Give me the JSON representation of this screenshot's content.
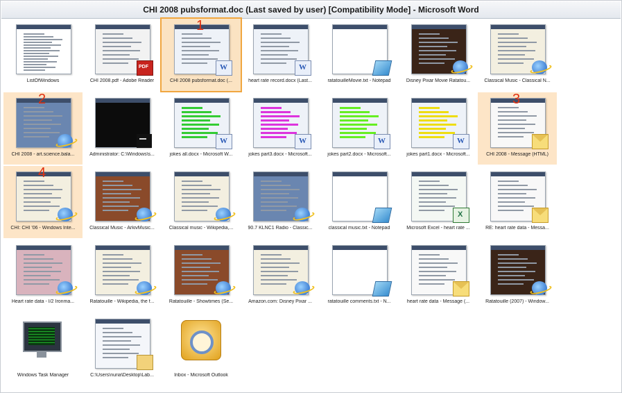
{
  "window": {
    "title": "CHI 2008 pubsformat.doc (Last saved by user) [Compatibility Mode] - Microsoft Word"
  },
  "accent_colors": {
    "highlight": "#fde5c7",
    "selected_border": "#f0a640",
    "number": "#e03010"
  },
  "rows": [
    [
      {
        "caption": "ListOfWindows",
        "badge": "none",
        "number": "",
        "state": "normal",
        "thumb": "list"
      },
      {
        "caption": "CHI 2008.pdf - Adobe Reader",
        "badge": "pdf-icon",
        "number": "",
        "state": "normal",
        "thumb": "pdf"
      },
      {
        "caption": "CHI 2008 pubsformat.doc (...",
        "badge": "word-doc-icon",
        "number": "1",
        "state": "selected",
        "thumb": "word"
      },
      {
        "caption": "heart rate record.docx (Last...",
        "badge": "word-doc-icon",
        "number": "",
        "state": "normal",
        "thumb": "word"
      },
      {
        "caption": "ratatouilleMovie.txt - Notepad",
        "badge": "notepad-icon",
        "number": "",
        "state": "normal",
        "thumb": "blank"
      },
      {
        "caption": "Disney Pixar Movie Ratatou...",
        "badge": "ie-icon",
        "number": "",
        "state": "normal",
        "thumb": "web-dark"
      },
      {
        "caption": "Classical Music - Classical N...",
        "badge": "ie-icon",
        "number": "",
        "state": "normal",
        "thumb": "web-light"
      }
    ],
    [
      {
        "caption": "CHI 2008 - art.science.bala...",
        "badge": "ie-icon",
        "number": "2",
        "state": "highlight",
        "thumb": "web-blue"
      },
      {
        "caption": "Administrator: C:\\Windows\\s...",
        "badge": "terminal-icon",
        "number": "",
        "state": "normal",
        "thumb": "console"
      },
      {
        "caption": "jokes all.docx - Microsoft W...",
        "badge": "word-doc-icon",
        "number": "",
        "state": "normal",
        "thumb": "word-green"
      },
      {
        "caption": "jokes part3.docx - Microsoft...",
        "badge": "word-doc-icon",
        "number": "",
        "state": "normal",
        "thumb": "word-magenta"
      },
      {
        "caption": "jokes part2.docx - Microsoft...",
        "badge": "word-doc-icon",
        "number": "",
        "state": "normal",
        "thumb": "word-lime"
      },
      {
        "caption": "jokes part1.docx - Microsoft...",
        "badge": "word-doc-icon",
        "number": "",
        "state": "normal",
        "thumb": "word-yellow"
      },
      {
        "caption": "CHI 2008 - Message (HTML)",
        "badge": "mail-icon",
        "number": "3",
        "state": "highlight",
        "thumb": "mail"
      }
    ],
    [
      {
        "caption": "CHI: CHI '06 - Windows Inte...",
        "badge": "ie-icon",
        "number": "4",
        "state": "highlight",
        "thumb": "web-light"
      },
      {
        "caption": "Classical Music - ArkivMusic...",
        "badge": "ie-icon",
        "number": "",
        "state": "normal",
        "thumb": "web-brown"
      },
      {
        "caption": "Classical music - Wikipedia,...",
        "badge": "ie-icon",
        "number": "",
        "state": "normal",
        "thumb": "web-light"
      },
      {
        "caption": "90.7 KLNC1 Radio - Classic...",
        "badge": "ie-icon",
        "number": "",
        "state": "normal",
        "thumb": "web-blue"
      },
      {
        "caption": "classical music.txt - Notepad",
        "badge": "notepad-icon",
        "number": "",
        "state": "normal",
        "thumb": "blank"
      },
      {
        "caption": "Microsoft Excel - heart rate ...",
        "badge": "excel-icon",
        "number": "",
        "state": "normal",
        "thumb": "sheet"
      },
      {
        "caption": "RE: heart rate data - Messa...",
        "badge": "mail-icon",
        "number": "",
        "state": "normal",
        "thumb": "mail"
      }
    ],
    [
      {
        "caption": "Heart rate data - I/2 Ironma...",
        "badge": "ie-icon",
        "number": "",
        "state": "normal",
        "thumb": "web-pink"
      },
      {
        "caption": "Ratatouille - Wikipedia, the f...",
        "badge": "ie-icon",
        "number": "",
        "state": "normal",
        "thumb": "web-light"
      },
      {
        "caption": "Ratatouille - Showtimes (Se...",
        "badge": "ie-icon",
        "number": "",
        "state": "normal",
        "thumb": "web-brown"
      },
      {
        "caption": "Amazon.com: Disney Pixar ...",
        "badge": "ie-icon",
        "number": "",
        "state": "normal",
        "thumb": "web-light"
      },
      {
        "caption": "ratatouille comments.txt - N...",
        "badge": "notepad-icon",
        "number": "",
        "state": "normal",
        "thumb": "blank"
      },
      {
        "caption": "heart rate data - Message (...",
        "badge": "mail-icon",
        "number": "",
        "state": "normal",
        "thumb": "mail"
      },
      {
        "caption": "Ratatouille (2007) - Window...",
        "badge": "ie-icon",
        "number": "",
        "state": "normal",
        "thumb": "web-dark"
      }
    ],
    [
      {
        "caption": "Windows Task Manager",
        "badge": "none",
        "number": "",
        "state": "normal",
        "thumb": "taskmgr"
      },
      {
        "caption": "C:\\Users\\nuria\\Desktop\\Lab...",
        "badge": "folder-icon",
        "number": "",
        "state": "normal",
        "thumb": "explorer"
      },
      {
        "caption": "Inbox - Microsoft Outlook",
        "badge": "none",
        "number": "",
        "state": "normal",
        "thumb": "outlook"
      }
    ]
  ]
}
